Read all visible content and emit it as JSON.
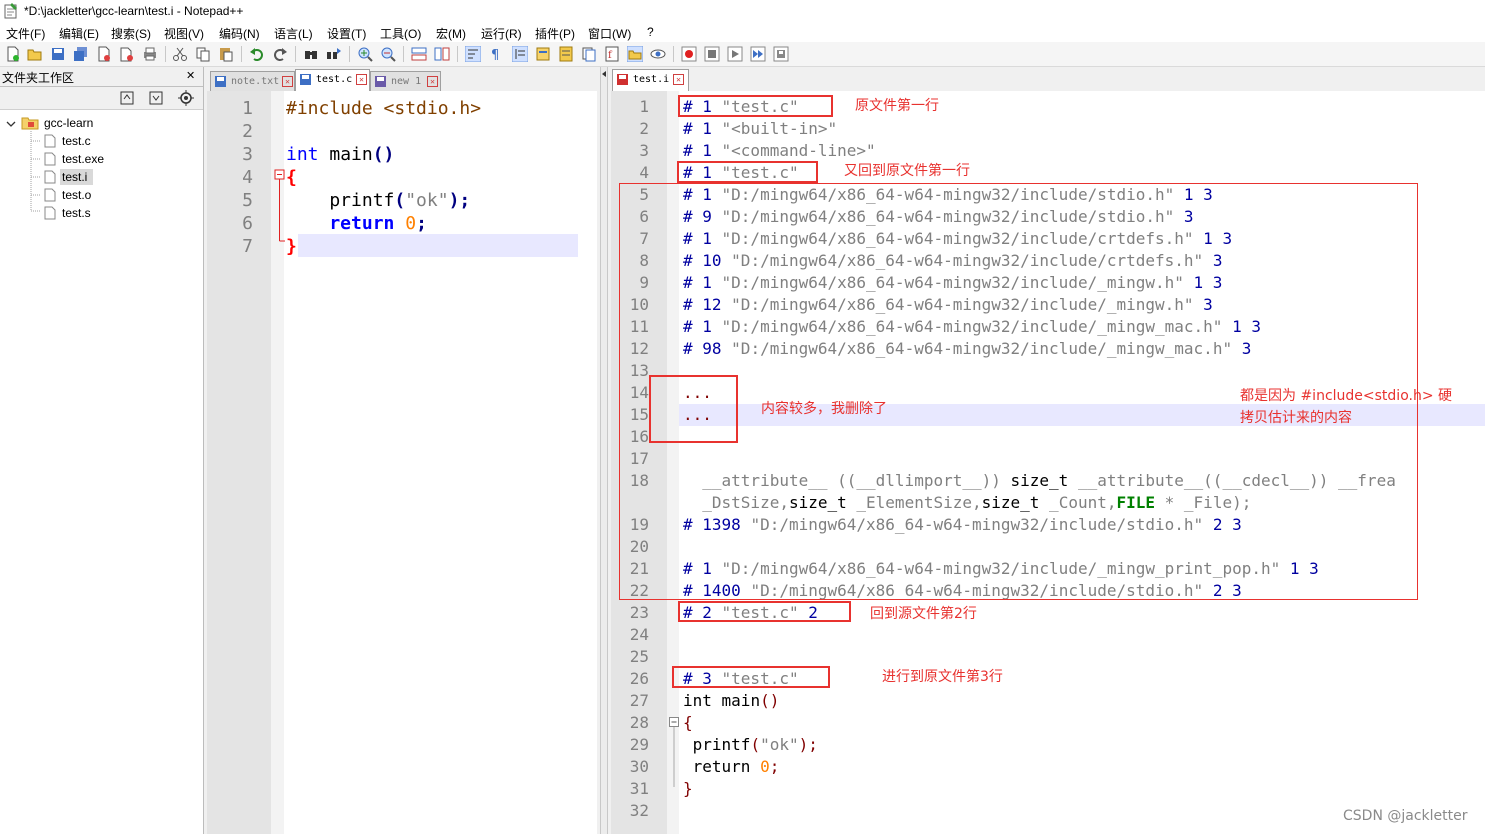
{
  "window": {
    "title": "*D:\\jackletter\\gcc-learn\\test.i - Notepad++"
  },
  "menu": [
    "文件(F)",
    "编辑(E)",
    "搜索(S)",
    "视图(V)",
    "编码(N)",
    "语言(L)",
    "设置(T)",
    "工具(O)",
    "宏(M)",
    "运行(R)",
    "插件(P)",
    "窗口(W)",
    "?"
  ],
  "folder_panel": {
    "title": "文件夹工作区",
    "close": "✕",
    "root": "gcc-learn",
    "files": [
      "test.c",
      "test.exe",
      "test.i",
      "test.o",
      "test.s"
    ]
  },
  "left_tabs": [
    {
      "label": "note.txt"
    },
    {
      "label": "test.c"
    },
    {
      "label": "new 1"
    }
  ],
  "right_tabs": [
    {
      "label": "test.i"
    }
  ],
  "left_editor": {
    "line_numbers": [
      "1",
      "2",
      "3",
      "4",
      "5",
      "6",
      "7"
    ],
    "lines": {
      "l1": "#include <stdio.h>",
      "l3a": "int",
      "l3b": " main",
      "l3c": "()",
      "l4": "{",
      "l5a": "    printf",
      "l5b": "(",
      "l5c": "\"ok\"",
      "l5d": ");",
      "l6a": "    return",
      "l6b": " 0",
      "l6c": ";",
      "l7": "}"
    }
  },
  "right_editor": {
    "line_numbers": [
      "1",
      "2",
      "3",
      "4",
      "5",
      "6",
      "7",
      "8",
      "9",
      "10",
      "11",
      "12",
      "13",
      "14",
      "15",
      "16",
      "17",
      "18",
      "",
      "19",
      "20",
      "21",
      "22",
      "23",
      "24",
      "25",
      "26",
      "27",
      "28",
      "29",
      "30",
      "31",
      "32"
    ],
    "lines": {
      "r1a": "# 1 ",
      "r1b": "\"test.c\"",
      "r2a": "# 1 ",
      "r2b": "\"<built-in>\"",
      "r3a": "# 1 ",
      "r3b": "\"<command-line>\"",
      "r4a": "# 1 ",
      "r4b": "\"test.c\"",
      "r5a": "# 1 ",
      "r5b": "\"D:/mingw64/x86_64-w64-mingw32/include/stdio.h\"",
      "r5c": " 1 3",
      "r6a": "# 9 ",
      "r6b": "\"D:/mingw64/x86_64-w64-mingw32/include/stdio.h\"",
      "r6c": " 3",
      "r7a": "# 1 ",
      "r7b": "\"D:/mingw64/x86_64-w64-mingw32/include/crtdefs.h\"",
      "r7c": " 1 3",
      "r8a": "# 10 ",
      "r8b": "\"D:/mingw64/x86_64-w64-mingw32/include/crtdefs.h\"",
      "r8c": " 3",
      "r9a": "# 1 ",
      "r9b": "\"D:/mingw64/x86_64-w64-mingw32/include/_mingw.h\"",
      "r9c": " 1 3",
      "r10a": "# 12 ",
      "r10b": "\"D:/mingw64/x86_64-w64-mingw32/include/_mingw.h\"",
      "r10c": " 3",
      "r11a": "# 1 ",
      "r11b": "\"D:/mingw64/x86_64-w64-mingw32/include/_mingw_mac.h\"",
      "r11c": " 1 3",
      "r12a": "# 98 ",
      "r12b": "\"D:/mingw64/x86_64-w64-mingw32/include/_mingw_mac.h\"",
      "r12c": " 3",
      "r14": "...",
      "r15": "...",
      "r18a": "  __attribute__ ((__dllimport__)) ",
      "r18b": "size_t",
      "r18c": " __attribute__((__cdecl__)) __frea",
      "r18d": "  _DstSize,",
      "r18e": "size_t",
      "r18f": " _ElementSize,",
      "r18g": "size_t",
      "r18h": " _Count,",
      "r18i": "FILE",
      "r18j": " * _File);",
      "r19a": "# 1398 ",
      "r19b": "\"D:/mingw64/x86_64-w64-mingw32/include/stdio.h\"",
      "r19c": " 2 3",
      "r21a": "# 1 ",
      "r21b": "\"D:/mingw64/x86_64-w64-mingw32/include/_mingw_print_pop.h\"",
      "r21c": " 1 3",
      "r22a": "# 1400 ",
      "r22b": "\"D:/mingw64/x86_64-w64-mingw32/include/stdio.h\"",
      "r22c": " 2 3",
      "r23a": "# 2 ",
      "r23b": "\"test.c\"",
      "r23c": " 2",
      "r26a": "# 3 ",
      "r26b": "\"test.c\"",
      "r27a": "int",
      "r27b": " main",
      "r27c": "()",
      "r28": "{",
      "r29a": " printf",
      "r29b": "(",
      "r29c": "\"ok\"",
      "r29d": ");",
      "r30a": " return",
      "r30b": " 0",
      "r30c": ";",
      "r31": "}"
    }
  },
  "annotations": {
    "a1": "原文件第一行",
    "a2": "又回到原文件第一行",
    "a3": "内容较多，我删除了",
    "a4a": "都是因为 #include<stdio.h> 硬",
    "a4b": "拷贝估计来的内容",
    "a5": "回到源文件第2行",
    "a6": "进行到原文件第3行"
  },
  "watermark": "CSDN @jackletter",
  "colors": {
    "annotation": "#e8322f",
    "current_line": "#e8e8ff",
    "keyword": "#0000ff",
    "string": "#808080",
    "directive": "#804000"
  }
}
